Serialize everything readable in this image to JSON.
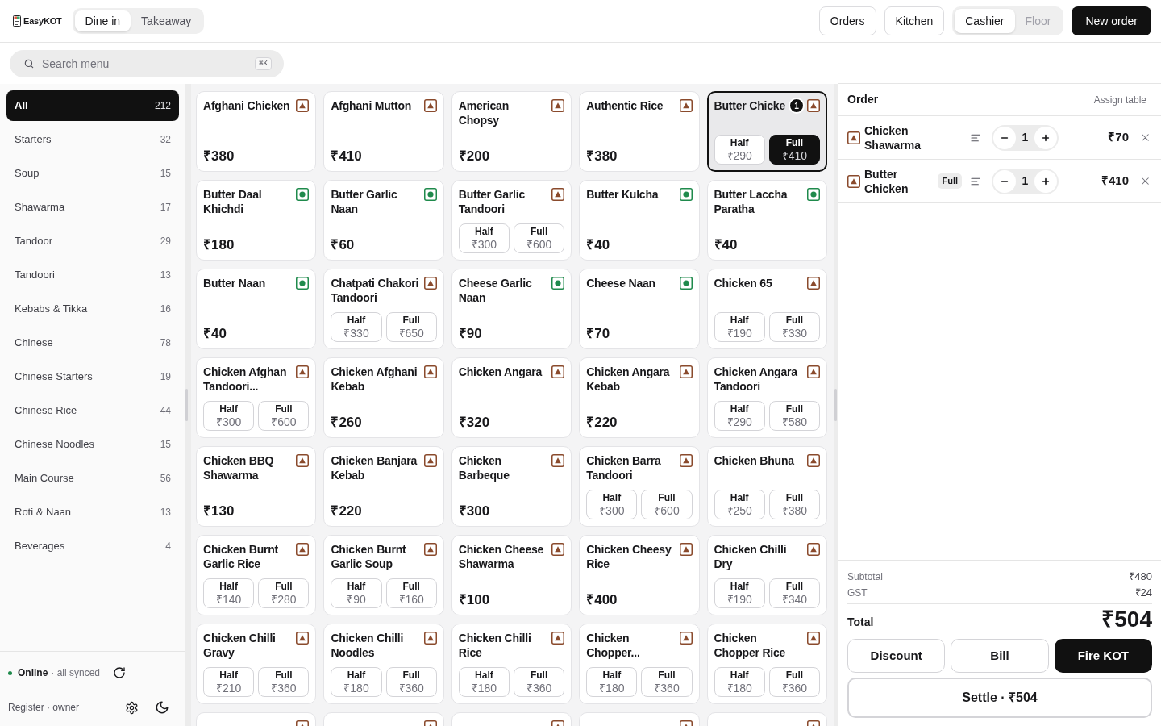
{
  "header": {
    "logo": "EasyKOT",
    "order_type_tabs": [
      {
        "label": "Dine in",
        "selected": true
      },
      {
        "label": "Takeaway",
        "selected": false
      }
    ],
    "nav_buttons": [
      "Orders",
      "Kitchen"
    ],
    "view_tabs": [
      {
        "label": "Cashier",
        "selected": true
      },
      {
        "label": "Floor",
        "selected": false
      }
    ],
    "new_order_button": "New order"
  },
  "search": {
    "placeholder": "Search menu",
    "shortcut": "⌘K"
  },
  "sidebar": {
    "categories": [
      {
        "name": "All",
        "count": "212",
        "selected": true
      },
      {
        "name": "Starters",
        "count": "32",
        "selected": false
      },
      {
        "name": "Soup",
        "count": "15",
        "selected": false
      },
      {
        "name": "Shawarma",
        "count": "17",
        "selected": false
      },
      {
        "name": "Tandoor",
        "count": "29",
        "selected": false
      },
      {
        "name": "Tandoori",
        "count": "13",
        "selected": false
      },
      {
        "name": "Kebabs & Tikka",
        "count": "16",
        "selected": false
      },
      {
        "name": "Chinese",
        "count": "78",
        "selected": false
      },
      {
        "name": "Chinese Starters",
        "count": "19",
        "selected": false
      },
      {
        "name": "Chinese Rice",
        "count": "44",
        "selected": false
      },
      {
        "name": "Chinese Noodles",
        "count": "15",
        "selected": false
      },
      {
        "name": "Main Course",
        "count": "56",
        "selected": false
      },
      {
        "name": "Roti & Naan",
        "count": "13",
        "selected": false
      },
      {
        "name": "Beverages",
        "count": "4",
        "selected": false
      }
    ],
    "status": {
      "label": "Online",
      "detail": "· all synced",
      "connected": true
    },
    "user": "Register · owner"
  },
  "menu": {
    "items": [
      {
        "name": "Afghani Chicken",
        "veg": false,
        "selected": false,
        "price": "₹380"
      },
      {
        "name": "Afghani Mutton",
        "veg": false,
        "selected": false,
        "price": "₹410"
      },
      {
        "name": "American Chopsy",
        "veg": false,
        "selected": false,
        "price": "₹200"
      },
      {
        "name": "Authentic Rice",
        "veg": false,
        "selected": false,
        "price": "₹380"
      },
      {
        "name": "Butter Chicke",
        "veg": false,
        "selected": true,
        "quantity": "1",
        "variants": [
          {
            "label": "Half",
            "price": "₹290",
            "selected": false
          },
          {
            "label": "Full",
            "price": "₹410",
            "selected": true
          }
        ]
      },
      {
        "name": "Butter Daal Khichdi",
        "veg": true,
        "selected": false,
        "price": "₹180"
      },
      {
        "name": "Butter Garlic Naan",
        "veg": true,
        "selected": false,
        "price": "₹60"
      },
      {
        "name": "Butter Garlic Tandoori",
        "veg": false,
        "selected": false,
        "variants": [
          {
            "label": "Half",
            "price": "₹300",
            "selected": false
          },
          {
            "label": "Full",
            "price": "₹600",
            "selected": false
          }
        ]
      },
      {
        "name": "Butter Kulcha",
        "veg": true,
        "selected": false,
        "price": "₹40"
      },
      {
        "name": "Butter Laccha Paratha",
        "veg": true,
        "selected": false,
        "price": "₹40"
      },
      {
        "name": "Butter Naan",
        "veg": true,
        "selected": false,
        "price": "₹40"
      },
      {
        "name": "Chatpati Chakori Tandoori",
        "veg": false,
        "selected": false,
        "variants": [
          {
            "label": "Half",
            "price": "₹330",
            "selected": false
          },
          {
            "label": "Full",
            "price": "₹650",
            "selected": false
          }
        ]
      },
      {
        "name": "Cheese Garlic Naan",
        "veg": true,
        "selected": false,
        "price": "₹90"
      },
      {
        "name": "Cheese Naan",
        "veg": true,
        "selected": false,
        "price": "₹70"
      },
      {
        "name": "Chicken 65",
        "veg": false,
        "selected": false,
        "variants": [
          {
            "label": "Half",
            "price": "₹190",
            "selected": false
          },
          {
            "label": "Full",
            "price": "₹330",
            "selected": false
          }
        ]
      },
      {
        "name": "Chicken Afghan Tandoori...",
        "veg": false,
        "selected": false,
        "variants": [
          {
            "label": "Half",
            "price": "₹300",
            "selected": false
          },
          {
            "label": "Full",
            "price": "₹600",
            "selected": false
          }
        ]
      },
      {
        "name": "Chicken Afghani Kebab",
        "veg": false,
        "selected": false,
        "price": "₹260"
      },
      {
        "name": "Chicken Angara",
        "veg": false,
        "selected": false,
        "price": "₹320"
      },
      {
        "name": "Chicken Angara Kebab",
        "veg": false,
        "selected": false,
        "price": "₹220"
      },
      {
        "name": "Chicken Angara Tandoori",
        "veg": false,
        "selected": false,
        "variants": [
          {
            "label": "Half",
            "price": "₹290",
            "selected": false
          },
          {
            "label": "Full",
            "price": "₹580",
            "selected": false
          }
        ]
      },
      {
        "name": "Chicken BBQ Shawarma",
        "veg": false,
        "selected": false,
        "price": "₹130"
      },
      {
        "name": "Chicken Banjara Kebab",
        "veg": false,
        "selected": false,
        "price": "₹220"
      },
      {
        "name": "Chicken Barbeque",
        "veg": false,
        "selected": false,
        "price": "₹300"
      },
      {
        "name": "Chicken Barra Tandoori",
        "veg": false,
        "selected": false,
        "variants": [
          {
            "label": "Half",
            "price": "₹300",
            "selected": false
          },
          {
            "label": "Full",
            "price": "₹600",
            "selected": false
          }
        ]
      },
      {
        "name": "Chicken Bhuna",
        "veg": false,
        "selected": false,
        "variants": [
          {
            "label": "Half",
            "price": "₹250",
            "selected": false
          },
          {
            "label": "Full",
            "price": "₹380",
            "selected": false
          }
        ]
      },
      {
        "name": "Chicken Burnt Garlic Rice",
        "veg": false,
        "selected": false,
        "variants": [
          {
            "label": "Half",
            "price": "₹140",
            "selected": false
          },
          {
            "label": "Full",
            "price": "₹280",
            "selected": false
          }
        ]
      },
      {
        "name": "Chicken Burnt Garlic Soup",
        "veg": false,
        "selected": false,
        "variants": [
          {
            "label": "Half",
            "price": "₹90",
            "selected": false
          },
          {
            "label": "Full",
            "price": "₹160",
            "selected": false
          }
        ]
      },
      {
        "name": "Chicken Cheese Shawarma",
        "veg": false,
        "selected": false,
        "price": "₹100"
      },
      {
        "name": "Chicken Cheesy Rice",
        "veg": false,
        "selected": false,
        "price": "₹400"
      },
      {
        "name": "Chicken Chilli Dry",
        "veg": false,
        "selected": false,
        "variants": [
          {
            "label": "Half",
            "price": "₹190",
            "selected": false
          },
          {
            "label": "Full",
            "price": "₹340",
            "selected": false
          }
        ]
      },
      {
        "name": "Chicken Chilli Gravy",
        "veg": false,
        "selected": false,
        "variants": [
          {
            "label": "Half",
            "price": "₹210",
            "selected": false
          },
          {
            "label": "Full",
            "price": "₹360",
            "selected": false
          }
        ]
      },
      {
        "name": "Chicken Chilli Noodles",
        "veg": false,
        "selected": false,
        "variants": [
          {
            "label": "Half",
            "price": "₹180",
            "selected": false
          },
          {
            "label": "Full",
            "price": "₹360",
            "selected": false
          }
        ]
      },
      {
        "name": "Chicken Chilli Rice",
        "veg": false,
        "selected": false,
        "variants": [
          {
            "label": "Half",
            "price": "₹180",
            "selected": false
          },
          {
            "label": "Full",
            "price": "₹360",
            "selected": false
          }
        ]
      },
      {
        "name": "Chicken Chopper...",
        "veg": false,
        "selected": false,
        "variants": [
          {
            "label": "Half",
            "price": "₹180",
            "selected": false
          },
          {
            "label": "Full",
            "price": "₹360",
            "selected": false
          }
        ]
      },
      {
        "name": "Chicken Chopper Rice",
        "veg": false,
        "selected": false,
        "variants": [
          {
            "label": "Half",
            "price": "₹180",
            "selected": false
          },
          {
            "label": "Full",
            "price": "₹360",
            "selected": false
          }
        ]
      },
      {
        "veg": false,
        "selected": false
      },
      {
        "veg": false,
        "selected": false
      },
      {
        "veg": false,
        "selected": false
      },
      {
        "veg": false,
        "selected": false
      },
      {
        "veg": false,
        "selected": false
      }
    ]
  },
  "order": {
    "title": "Order",
    "assign_table": "Assign table",
    "items": [
      {
        "name": "Chicken Shawarma",
        "veg": false,
        "quantity": "1",
        "price": "₹70"
      },
      {
        "name": "Butter Chicken",
        "veg": false,
        "variant": "Full",
        "quantity": "1",
        "price": "₹410"
      }
    ],
    "subtotal": {
      "label": "Subtotal",
      "value": "₹480"
    },
    "tax": {
      "label": "GST",
      "value": "₹24"
    },
    "total": {
      "label": "Total",
      "value": "₹504"
    },
    "actions": [
      {
        "label": "Discount",
        "primary": false
      },
      {
        "label": "Bill",
        "primary": false
      },
      {
        "label": "Fire KOT",
        "primary": true
      }
    ],
    "settle_button": "Settle · ₹504"
  }
}
